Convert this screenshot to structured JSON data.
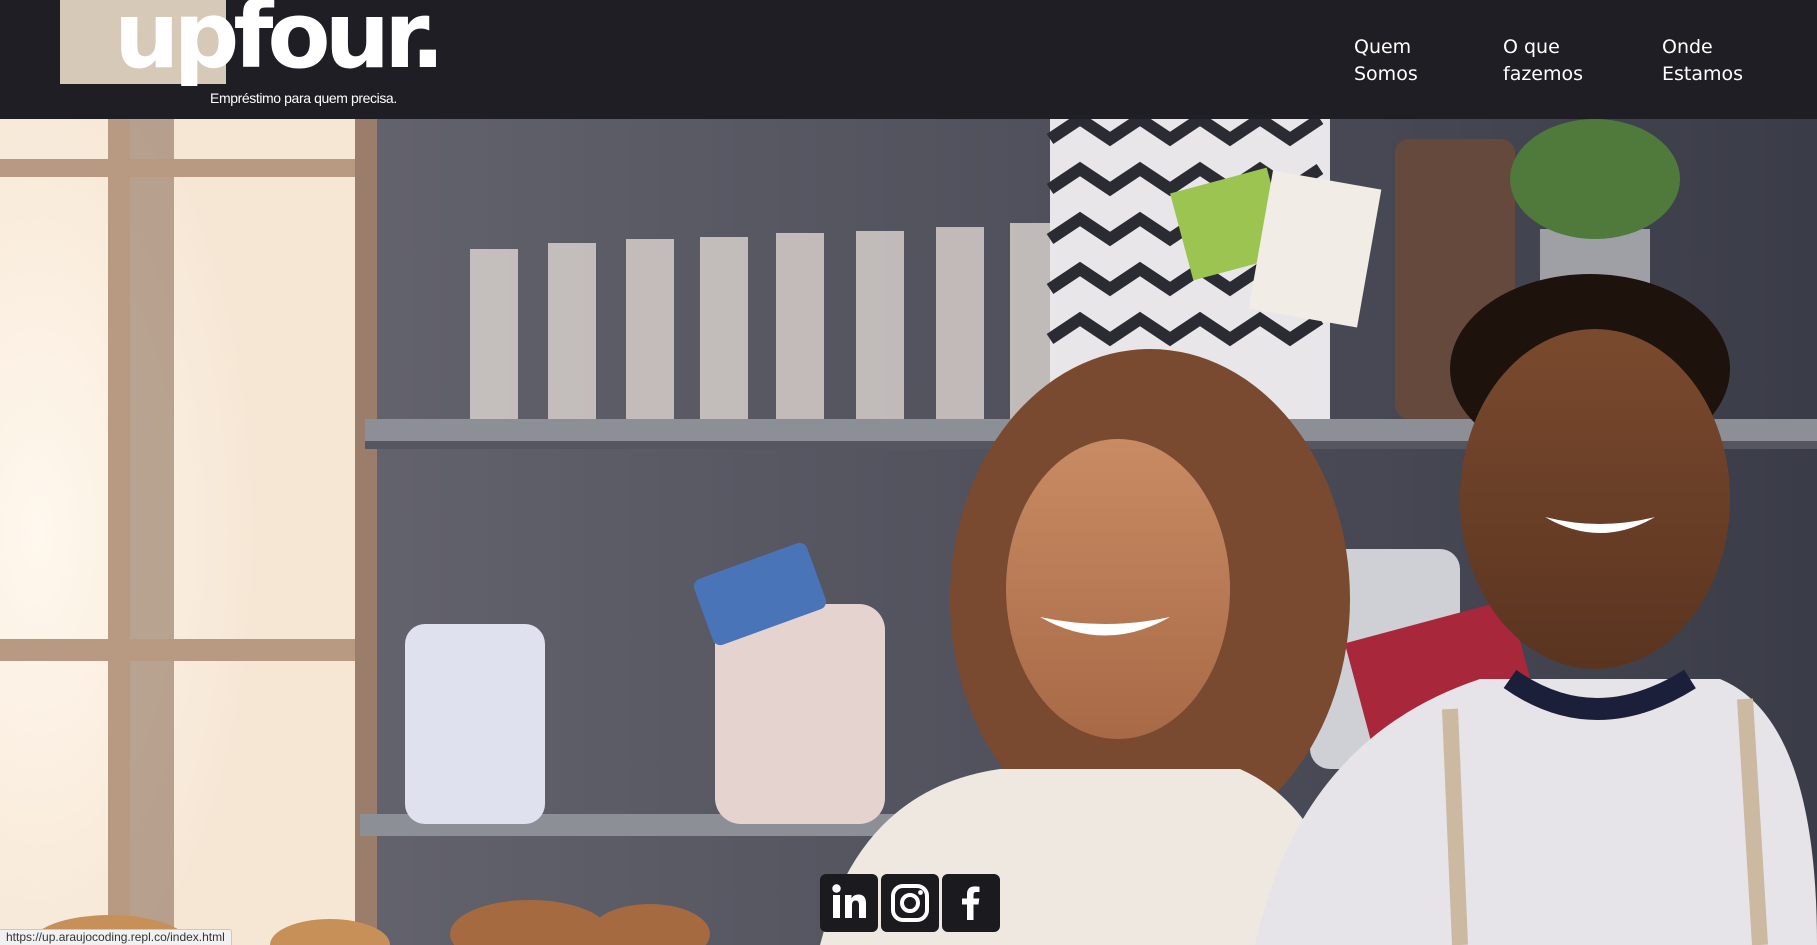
{
  "colors": {
    "header_bg": "#1e1e24",
    "logo_block": "#d6c9b8",
    "text": "#ffffff",
    "social_bg": "#1a1a1f"
  },
  "logo": {
    "wordmark": "upfour.",
    "tagline": "Empréstimo para quem precisa."
  },
  "nav": [
    {
      "line1": "Quem",
      "line2": "Somos"
    },
    {
      "line1": "O que",
      "line2": "fazemos"
    },
    {
      "line1": "Onde",
      "line2": "Estamos"
    }
  ],
  "social": [
    {
      "icon": "linkedin-icon",
      "label": "in"
    },
    {
      "icon": "instagram-icon",
      "label": ""
    },
    {
      "icon": "facebook-icon",
      "label": "f"
    }
  ],
  "status_url": "https://up.araujocoding.repl.co/index.html"
}
